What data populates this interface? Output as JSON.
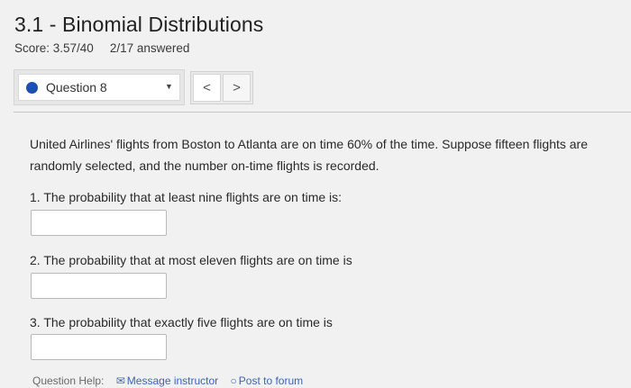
{
  "header": {
    "title": "3.1 - Binomial Distributions",
    "score": "Score: 3.57/40",
    "answered": "2/17 answered"
  },
  "question_nav": {
    "selected": "Question 8",
    "prev_symbol": "<",
    "next_symbol": ">"
  },
  "question": {
    "prompt": "United Airlines' flights from Boston to Atlanta are on time 60% of the time. Suppose fifteen flights are randomly selected, and the number on-time flights is recorded.",
    "items": [
      {
        "label": "1. The probability that at least nine flights are on time is:",
        "value": ""
      },
      {
        "label": "2. The probability that at most eleven flights are on time is",
        "value": ""
      },
      {
        "label": "3. The probability that exactly five flights are on time is",
        "value": ""
      }
    ]
  },
  "footer": {
    "help_label": "Question Help:",
    "message_label": "Message instructor",
    "forum_label": "Post to forum"
  },
  "colors": {
    "accent": "#1a4fb4",
    "background": "#f1f1f1"
  }
}
